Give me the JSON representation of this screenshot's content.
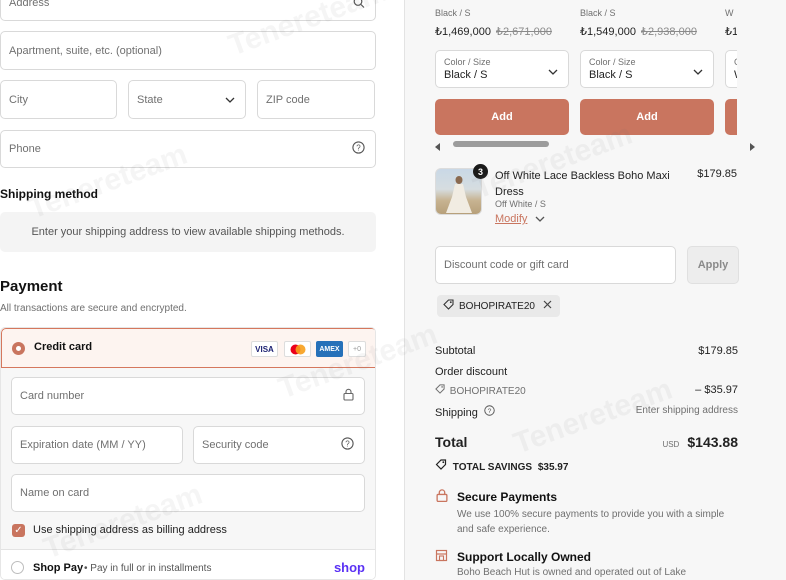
{
  "watermark": "Tenereteam",
  "contact_form": {
    "address_placeholder": "Address",
    "apartment_placeholder": "Apartment, suite, etc. (optional)",
    "city_placeholder": "City",
    "state_label": "State",
    "zip_placeholder": "ZIP code",
    "phone_placeholder": "Phone"
  },
  "shipping": {
    "title": "Shipping method",
    "message": "Enter your shipping address to view available shipping methods."
  },
  "payment": {
    "title": "Payment",
    "subtitle": "All transactions are secure and encrypted.",
    "credit_card_label": "Credit card",
    "card_logos": [
      "VISA",
      "",
      "AMEX",
      "+0"
    ],
    "card_number_placeholder": "Card number",
    "expiration_placeholder": "Expiration date (MM / YY)",
    "security_code_placeholder": "Security code",
    "name_on_card_placeholder": "Name on card",
    "billing_checkbox_label": "Use shipping address as billing address",
    "billing_checked": true,
    "shop_pay_label": "Shop Pay",
    "shop_pay_sub": "• Pay in full or in installments",
    "shop_pay_logo": "shop"
  },
  "recommendations": [
    {
      "meta": "Black / S",
      "price": "₺1,469,000",
      "compare": "₺2,671,000",
      "size_label": "Color / Size",
      "size_value": "Black / S",
      "add_label": "Add"
    },
    {
      "meta": "Black / S",
      "price": "₺1,549,000",
      "compare": "₺2,938,000",
      "size_label": "Color / Size",
      "size_value": "Black / S",
      "add_label": "Add"
    },
    {
      "meta": "W",
      "price": "₺1,",
      "compare": "",
      "size_label": "C",
      "size_value": "W",
      "add_label": ""
    }
  ],
  "cart_item": {
    "quantity": "3",
    "title": "Off White Lace Backless Boho Maxi Dress",
    "variant": "Off White / S",
    "modify_label": "Modify",
    "price": "$179.85"
  },
  "discount": {
    "placeholder": "Discount code or gift card",
    "apply_label": "Apply",
    "applied_code": "BOHOPIRATE20"
  },
  "summary": {
    "subtotal_label": "Subtotal",
    "subtotal_value": "$179.85",
    "order_discount_label": "Order discount",
    "discount_code": "BOHOPIRATE20",
    "discount_value": "– $35.97",
    "shipping_label": "Shipping",
    "shipping_value": "Enter shipping address",
    "total_label": "Total",
    "currency": "USD",
    "total_value": "$143.88",
    "savings_label": "TOTAL SAVINGS",
    "savings_value": "$35.97"
  },
  "trust": [
    {
      "title": "Secure Payments",
      "text": "We use 100% secure payments to provide you with a simple and safe experience."
    },
    {
      "title": "Support Locally Owned",
      "text": "Boho Beach Hut is owned and operated out of Lake"
    }
  ],
  "colors": {
    "accent": "#c9755f",
    "accent_text": "#c9755f",
    "shop_pay": "#5a31f4"
  }
}
